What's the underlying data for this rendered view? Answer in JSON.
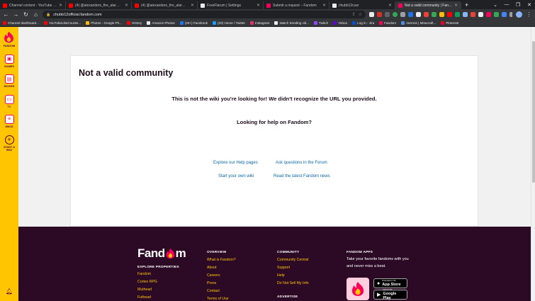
{
  "browser": {
    "tabs": [
      {
        "title": "Channel content - YouTube Studio",
        "color": "#ff0000",
        "active": false
      },
      {
        "title": "(4) @alexanders_fire_alarms301",
        "color": "#ff0000",
        "active": false
      },
      {
        "title": "(4) @alexanders_fire_alarms301",
        "color": "#ff0000",
        "active": false
      },
      {
        "title": "FreeFlarum | Settings",
        "color": "#e8eaed",
        "active": false
      },
      {
        "title": "Submit a request – Fandom",
        "color": "#fa005a",
        "active": false
      },
      {
        "title": "chubb12cuw",
        "color": "#e8eaed",
        "active": false
      },
      {
        "title": "Not a valid community | Fandom",
        "color": "#fa005a",
        "active": true
      }
    ],
    "new_tab": "+",
    "url": "chubb12official.fandom.com",
    "bookmarks": [
      {
        "label": "Channel dashboard...",
        "color": "#ff0000"
      },
      {
        "label": "YouTubeLikeCounte...",
        "color": "#ff0000"
      },
      {
        "label": "Photos - Google Ph...",
        "color": "#fbbc04"
      },
      {
        "label": "History",
        "color": "#ff0000"
      },
      {
        "label": "Amazon Photos",
        "color": "#e8eaed"
      },
      {
        "label": "(20+) Facebook",
        "color": "#1877f2"
      },
      {
        "label": "(20) Home / Twitter",
        "color": "#1d9bf0"
      },
      {
        "label": "Instagram",
        "color": "#e1306c"
      },
      {
        "label": "Watch trending vid...",
        "color": "#e8eaed"
      },
      {
        "label": "Twitch",
        "color": "#9146ff"
      },
      {
        "label": "Yahoo",
        "color": "#6001d2"
      },
      {
        "label": "Log in - Jira",
        "color": "#0052cc"
      },
      {
        "label": "Fandom",
        "color": "#fa005a"
      },
      {
        "label": "Aternos | Minecraft...",
        "color": "#4a90e2"
      },
      {
        "label": "Pinterest",
        "color": "#e60023"
      }
    ]
  },
  "rail": {
    "logo_label": "FANDOM",
    "items": [
      {
        "label": "GAMES",
        "glyph": "▣"
      },
      {
        "label": "MOVIES",
        "glyph": "▤"
      },
      {
        "label": "TV",
        "glyph": "▭"
      },
      {
        "label": "WIKIS",
        "glyph": "≡"
      }
    ],
    "start_wiki": {
      "label_1": "START A",
      "label_2": "WIKI"
    }
  },
  "main": {
    "title": "Not a valid community",
    "message": "This is not the wiki you're looking for! We didn't recognize the URL you provided.",
    "help_heading": "Looking for help on Fandom?",
    "links": {
      "help_pages": "Explore our Help pages",
      "forum": "Ask questions in the Forum",
      "start_wiki": "Start your own wiki",
      "news": "Read the latest Fandom news"
    }
  },
  "footer": {
    "logo_left": "Fand",
    "logo_right": "m",
    "explore": {
      "heading": "EXPLORE PROPERTIES",
      "items": [
        "Fandom",
        "Cortex RPG",
        "Muthead",
        "Futhead"
      ]
    },
    "overview": {
      "heading": "OVERVIEW",
      "items": [
        "What is Fandom?",
        "About",
        "Careers",
        "Press",
        "Contact",
        "Terms of Use"
      ]
    },
    "community": {
      "heading": "COMMUNITY",
      "items": [
        "Community Central",
        "Support",
        "Help",
        "Do Not Sell My Info"
      ]
    },
    "advertise": {
      "heading": "ADVERTISE"
    },
    "apps": {
      "heading": "FANDOM APPS",
      "text": "Take your favorite fandoms with you and never miss a beat.",
      "app_store_small": "Download on the",
      "app_store_big": "App Store",
      "google_play_small": "GET IT ON",
      "google_play_big": "Google Play"
    }
  },
  "colors": {
    "accent": "#fa005a",
    "rail": "#ffc500",
    "footer": "#2c0a25",
    "link": "#0a68a8"
  }
}
